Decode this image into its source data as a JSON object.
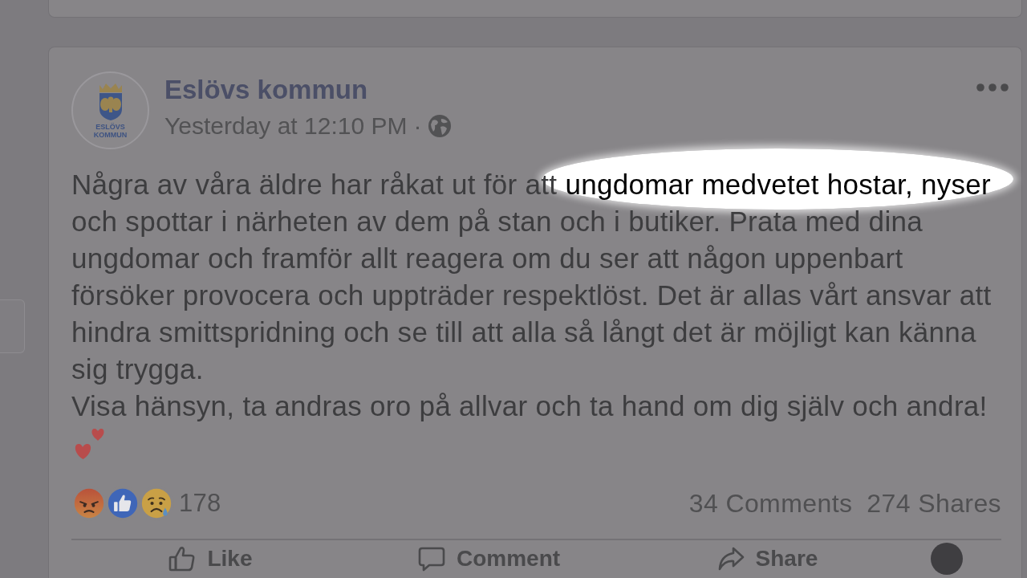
{
  "post": {
    "page_name": "Eslövs kommun",
    "avatar": {
      "logo_text": [
        "ESLÖVS",
        "KOMMUN"
      ]
    },
    "timestamp": "Yesterday at 12:10 PM",
    "separator": "·",
    "message": {
      "paragraphs": [
        {
          "lines": [
            {
              "segments": [
                {
                  "text": "Några av våra äldre har råkat ut för att ",
                  "highlighted": false
                },
                {
                  "text": "ungdomar medvetet hostar, nyser",
                  "highlighted": true
                }
              ]
            },
            {
              "segments": [
                {
                  "text": "och spottar i närheten av dem på stan och i butiker. Prata med dina",
                  "highlighted": false
                }
              ]
            },
            {
              "segments": [
                {
                  "text": "ungdomar och framför allt reagera om du ser att någon uppenbart",
                  "highlighted": false
                }
              ]
            },
            {
              "segments": [
                {
                  "text": "försöker provocera och uppträder respektlöst. Det är allas vårt ansvar att",
                  "highlighted": false
                }
              ]
            },
            {
              "segments": [
                {
                  "text": "hindra smittspridning och se till att alla så långt det är möjligt kan känna",
                  "highlighted": false
                }
              ]
            },
            {
              "segments": [
                {
                  "text": "sig trygga.",
                  "highlighted": false
                }
              ]
            }
          ]
        },
        {
          "lines": [
            {
              "segments": [
                {
                  "text": "Visa hänsyn, ta andras oro på allvar och ta hand om dig själv och andra!",
                  "highlighted": false
                }
              ]
            }
          ]
        }
      ]
    },
    "reactions": {
      "types": [
        {
          "kind": "angry"
        },
        {
          "kind": "like"
        },
        {
          "kind": "sad"
        }
      ],
      "count": "178"
    },
    "comments": "34 Comments",
    "shares": "274 Shares",
    "actions": [
      {
        "kind": "like",
        "label": "Like"
      },
      {
        "kind": "comment",
        "label": "Comment"
      },
      {
        "kind": "share",
        "label": "Share"
      }
    ]
  }
}
